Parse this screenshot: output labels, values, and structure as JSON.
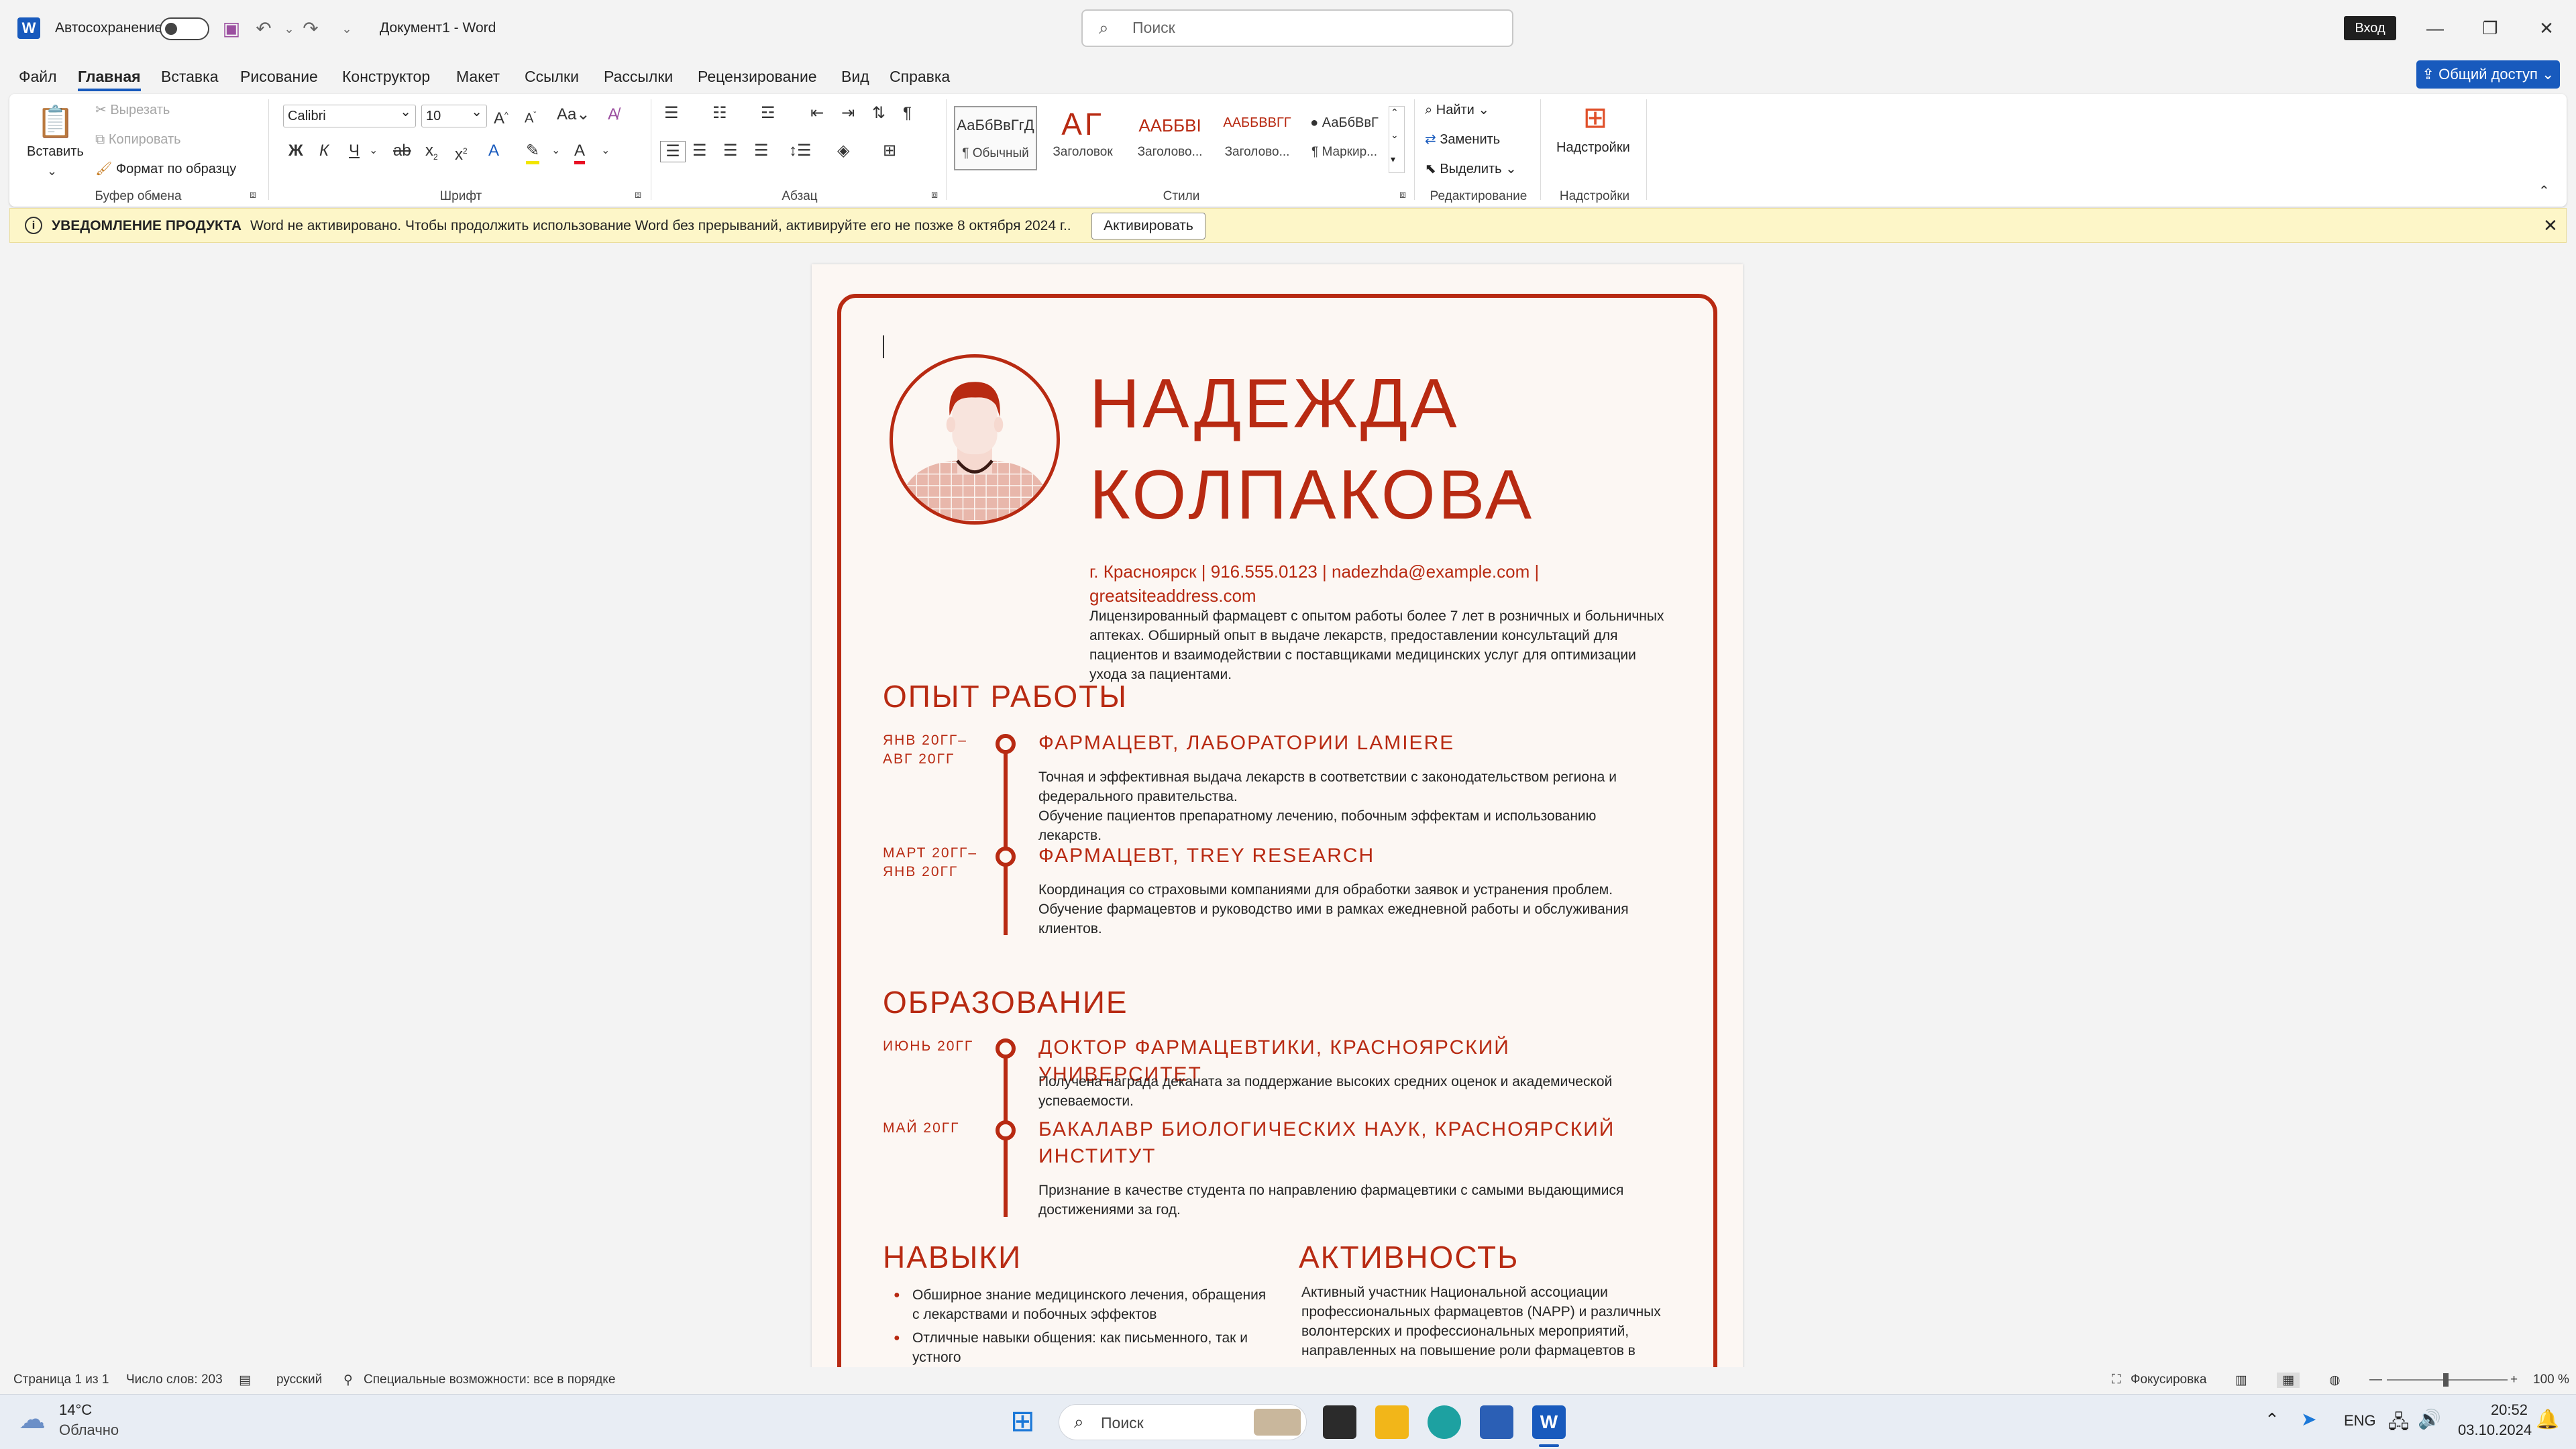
{
  "titlebar": {
    "autosave_label": "Автосохранение",
    "doc_title": "Документ1  -  Word",
    "search_placeholder": "Поиск",
    "signin_label": "Вход",
    "minimize": "—",
    "restore": "❐",
    "close": "✕"
  },
  "menu": {
    "tabs": [
      "Файл",
      "Главная",
      "Вставка",
      "Рисование",
      "Конструктор",
      "Макет",
      "Ссылки",
      "Рассылки",
      "Рецензирование",
      "Вид",
      "Справка"
    ],
    "share_label": "Общий доступ"
  },
  "ribbon": {
    "clipboard": {
      "paste": "Вставить",
      "cut": "Вырезать",
      "copy": "Копировать",
      "format_painter": "Формат по образцу",
      "label": "Буфер обмена"
    },
    "font": {
      "font_name": "Calibri",
      "font_size": "10",
      "label": "Шрифт"
    },
    "paragraph": {
      "label": "Абзац"
    },
    "styles": {
      "label": "Стили",
      "items": [
        {
          "preview": "АаБбВвГгД",
          "name": "¶ Обычный"
        },
        {
          "preview": "АГ",
          "name": "Заголовок"
        },
        {
          "preview": "ААББВІ",
          "name": "Заголово..."
        },
        {
          "preview": "ААББВВГГ",
          "name": "Заголово..."
        },
        {
          "preview": "● АаБбВвГ",
          "name": "¶ Маркир..."
        }
      ]
    },
    "editing": {
      "find": "Найти",
      "replace": "Заменить",
      "select": "Выделить",
      "label": "Редактирование"
    },
    "addins": {
      "button": "Надстройки",
      "label": "Надстройки"
    }
  },
  "notification": {
    "label": "УВЕДОМЛЕНИЕ ПРОДУКТА",
    "message": "Word не активировано. Чтобы продолжить использование Word без прерываний, активируйте его не позже 8 октября 2024 г..",
    "action": "Активировать"
  },
  "resume": {
    "name_line1": "НАДЕЖДА",
    "name_line2": "КОЛПАКОВА",
    "contact_line1": "г. Красноярск | 916.555.0123 | nadezhda@example.com |",
    "contact_line2": "greatsiteaddress.com",
    "summary": "Лицензированный фармацевт с опытом работы более 7 лет в розничных и больничных аптеках. Обширный опыт в выдаче лекарств, предоставлении консультаций для пациентов и взаимодействии с поставщиками медицинских услуг для оптимизации ухода за пациентами.",
    "experience": {
      "title": "ОПЫТ РАБОТЫ",
      "jobs": [
        {
          "date_line1": "ЯНВ 20ГГ–",
          "date_line2": "АВГ 20ГГ",
          "title": "ФАРМАЦЕВТ, ЛАБОРАТОРИИ LAMIERE",
          "desc1": "Точная и эффективная выдача лекарств в соответствии с законодательством региона и федерального правительства.",
          "desc2": "Обучение пациентов препаратному лечению, побочным эффектам и использованию лекарств."
        },
        {
          "date_line1": "МАРТ 20ГГ–",
          "date_line2": "ЯНВ 20ГГ",
          "title": "ФАРМАЦЕВТ, TREY RESEARCH",
          "desc1": "Координация со страховыми компаниями для обработки заявок и устранения проблем.",
          "desc2": "Обучение фармацевтов и руководство ими в рамках ежедневной работы и обслуживания клиентов."
        }
      ]
    },
    "education": {
      "title": "ОБРАЗОВАНИЕ",
      "items": [
        {
          "date": "ИЮНЬ 20ГГ",
          "title": "ДОКТОР ФАРМАЦЕВТИКИ, КРАСНОЯРСКИЙ УНИВЕРСИТЕТ",
          "desc": "Получена награда деканата за поддержание высоких средних оценок и академической успеваемости."
        },
        {
          "date": "МАЙ 20ГГ",
          "title_line1": "БАКАЛАВР БИОЛОГИЧЕСКИХ НАУК, КРАСНОЯРСКИЙ",
          "title_line2": "ИНСТИТУТ",
          "desc": "Признание в качестве студента по направлению фармацевтики с самыми выдающимися достижениями за год."
        }
      ]
    },
    "skills": {
      "title": "НАВЫКИ",
      "items": [
        "Обширное знание медицинского лечения, обращения с лекарствами и побочных эффектов",
        "Отличные навыки общения: как письменного, так и устного"
      ]
    },
    "activity": {
      "title": "АКТИВНОСТЬ",
      "text": "Активный участник Национальной ассоциации профессиональных фармацевтов (NAPP) и различных волонтерских и профессиональных мероприятий, направленных на повышение роли фармацевтов в"
    }
  },
  "status": {
    "page": "Страница 1 из 1",
    "words": "Число слов: 203",
    "language": "русский",
    "accessibility": "Специальные возможности: все в порядке",
    "focus": "Фокусировка",
    "zoom": "100 %"
  },
  "taskbar": {
    "temp": "14°C",
    "weather": "Облачно",
    "search": "Поиск",
    "lang": "ENG",
    "time": "20:52",
    "date": "03.10.2024"
  },
  "colors": {
    "accent": "#b82a12",
    "brand": "#185abd",
    "notice": "#fdf6c8"
  }
}
